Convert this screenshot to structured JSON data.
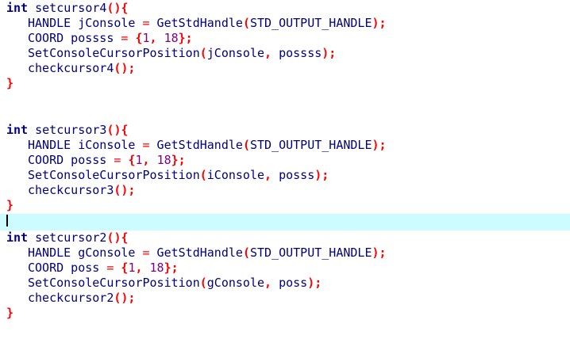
{
  "editor": {
    "lines": [
      [
        {
          "t": "int",
          "c": "kw"
        },
        {
          "t": " setcursor4",
          "c": "id"
        },
        {
          "t": "(){",
          "c": "p"
        }
      ],
      [
        {
          "t": "HANDLE jConsole ",
          "c": "id"
        },
        {
          "t": "=",
          "c": "op"
        },
        {
          "t": " GetStdHandle",
          "c": "id"
        },
        {
          "t": "(",
          "c": "p"
        },
        {
          "t": "STD_OUTPUT_HANDLE",
          "c": "id"
        },
        {
          "t": ");",
          "c": "p"
        }
      ],
      [
        {
          "t": "COORD possss ",
          "c": "id"
        },
        {
          "t": "=",
          "c": "op"
        },
        {
          "t": " ",
          "c": "id"
        },
        {
          "t": "{",
          "c": "p"
        },
        {
          "t": "1",
          "c": "num"
        },
        {
          "t": ", ",
          "c": "p"
        },
        {
          "t": "18",
          "c": "num"
        },
        {
          "t": "};",
          "c": "p"
        }
      ],
      [
        {
          "t": "SetConsoleCursorPosition",
          "c": "id"
        },
        {
          "t": "(",
          "c": "p"
        },
        {
          "t": "jConsole",
          "c": "id"
        },
        {
          "t": ", ",
          "c": "p"
        },
        {
          "t": "possss",
          "c": "id"
        },
        {
          "t": ");",
          "c": "p"
        }
      ],
      [
        {
          "t": "checkcursor4",
          "c": "id"
        },
        {
          "t": "();",
          "c": "p"
        }
      ],
      [
        {
          "t": "}",
          "c": "p"
        }
      ],
      [],
      [
        {
          "t": "int",
          "c": "kw"
        },
        {
          "t": " setcursor3",
          "c": "id"
        },
        {
          "t": "(){",
          "c": "p"
        }
      ],
      [
        {
          "t": "HANDLE iConsole ",
          "c": "id"
        },
        {
          "t": "=",
          "c": "op"
        },
        {
          "t": " GetStdHandle",
          "c": "id"
        },
        {
          "t": "(",
          "c": "p"
        },
        {
          "t": "STD_OUTPUT_HANDLE",
          "c": "id"
        },
        {
          "t": ");",
          "c": "p"
        }
      ],
      [
        {
          "t": "COORD posss ",
          "c": "id"
        },
        {
          "t": "=",
          "c": "op"
        },
        {
          "t": " ",
          "c": "id"
        },
        {
          "t": "{",
          "c": "p"
        },
        {
          "t": "1",
          "c": "num"
        },
        {
          "t": ", ",
          "c": "p"
        },
        {
          "t": "18",
          "c": "num"
        },
        {
          "t": "};",
          "c": "p"
        }
      ],
      [
        {
          "t": "SetConsoleCursorPosition",
          "c": "id"
        },
        {
          "t": "(",
          "c": "p"
        },
        {
          "t": "iConsole",
          "c": "id"
        },
        {
          "t": ", ",
          "c": "p"
        },
        {
          "t": "posss",
          "c": "id"
        },
        {
          "t": ");",
          "c": "p"
        }
      ],
      [
        {
          "t": "checkcursor3",
          "c": "id"
        },
        {
          "t": "();",
          "c": "p"
        }
      ],
      [
        {
          "t": "}",
          "c": "p"
        }
      ],
      [],
      [
        {
          "t": "int",
          "c": "kw"
        },
        {
          "t": " setcursor2",
          "c": "id"
        },
        {
          "t": "(){",
          "c": "p"
        }
      ],
      [
        {
          "t": "HANDLE gConsole ",
          "c": "id"
        },
        {
          "t": "=",
          "c": "op"
        },
        {
          "t": " GetStdHandle",
          "c": "id"
        },
        {
          "t": "(",
          "c": "p"
        },
        {
          "t": "STD_OUTPUT_HANDLE",
          "c": "id"
        },
        {
          "t": ");",
          "c": "p"
        }
      ],
      [
        {
          "t": "COORD poss ",
          "c": "id"
        },
        {
          "t": "=",
          "c": "op"
        },
        {
          "t": " ",
          "c": "id"
        },
        {
          "t": "{",
          "c": "p"
        },
        {
          "t": "1",
          "c": "num"
        },
        {
          "t": ", ",
          "c": "p"
        },
        {
          "t": "18",
          "c": "num"
        },
        {
          "t": "};",
          "c": "p"
        }
      ],
      [
        {
          "t": "SetConsoleCursorPosition",
          "c": "id"
        },
        {
          "t": "(",
          "c": "p"
        },
        {
          "t": "gConsole",
          "c": "id"
        },
        {
          "t": ", ",
          "c": "p"
        },
        {
          "t": "poss",
          "c": "id"
        },
        {
          "t": ");",
          "c": "p"
        }
      ],
      [
        {
          "t": "checkcursor2",
          "c": "id"
        },
        {
          "t": "();",
          "c": "p"
        }
      ],
      [
        {
          "t": "}",
          "c": "p"
        }
      ]
    ]
  }
}
